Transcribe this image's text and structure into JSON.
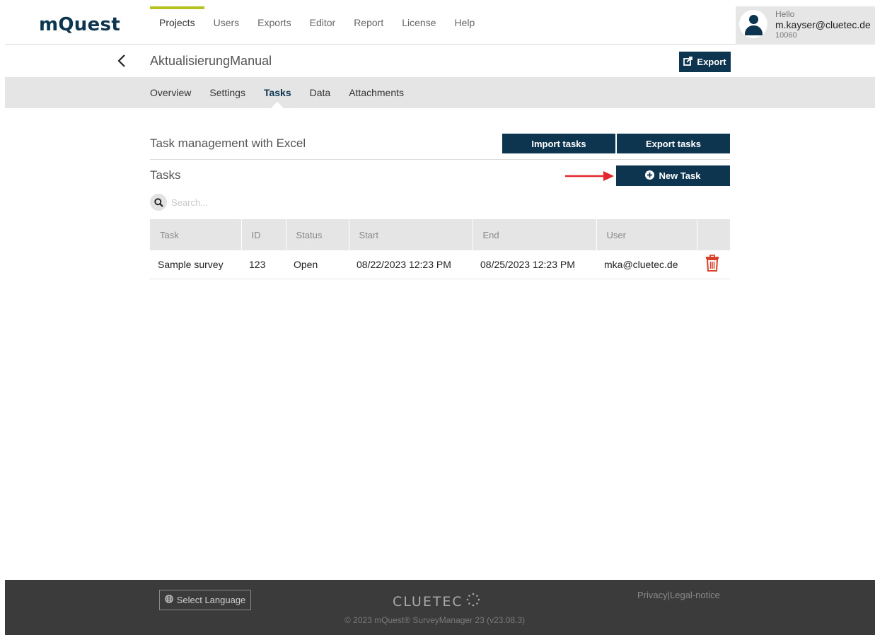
{
  "header": {
    "logo": "mQuest",
    "nav": [
      "Projects",
      "Users",
      "Exports",
      "Editor",
      "Report",
      "License",
      "Help"
    ],
    "active_nav": "Projects",
    "user": {
      "hello": "Hello",
      "email": "m.kayser@cluetec.de",
      "id": "10060"
    }
  },
  "project": {
    "title": "AktualisierungManual",
    "export_label": "Export"
  },
  "subnav": {
    "items": [
      "Overview",
      "Settings",
      "Tasks",
      "Data",
      "Attachments"
    ],
    "active": "Tasks"
  },
  "excel": {
    "title": "Task management with Excel",
    "import_label": "Import tasks",
    "export_label": "Export tasks"
  },
  "tasks": {
    "title": "Tasks",
    "new_task_label": "New Task",
    "search_placeholder": "Search...",
    "columns": [
      "Task",
      "ID",
      "Status",
      "Start",
      "End",
      "User",
      ""
    ],
    "rows": [
      {
        "task": "Sample survey",
        "id": "123",
        "status": "Open",
        "start": "08/22/2023 12:23 PM",
        "end": "08/25/2023 12:23 PM",
        "user": "mka@cluetec.de"
      }
    ]
  },
  "footer": {
    "language_label": "Select Language",
    "brand": "CLUETEC",
    "copyright": "© 2023 mQuest® SurveyManager 23 (v23.08.3)",
    "privacy": "Privacy",
    "separator": "|",
    "legal": "Legal-notice"
  },
  "colors": {
    "primary": "#0d3550",
    "accent": "#b6c21f",
    "danger": "#d9412b",
    "annotation_arrow": "#e3262b"
  }
}
